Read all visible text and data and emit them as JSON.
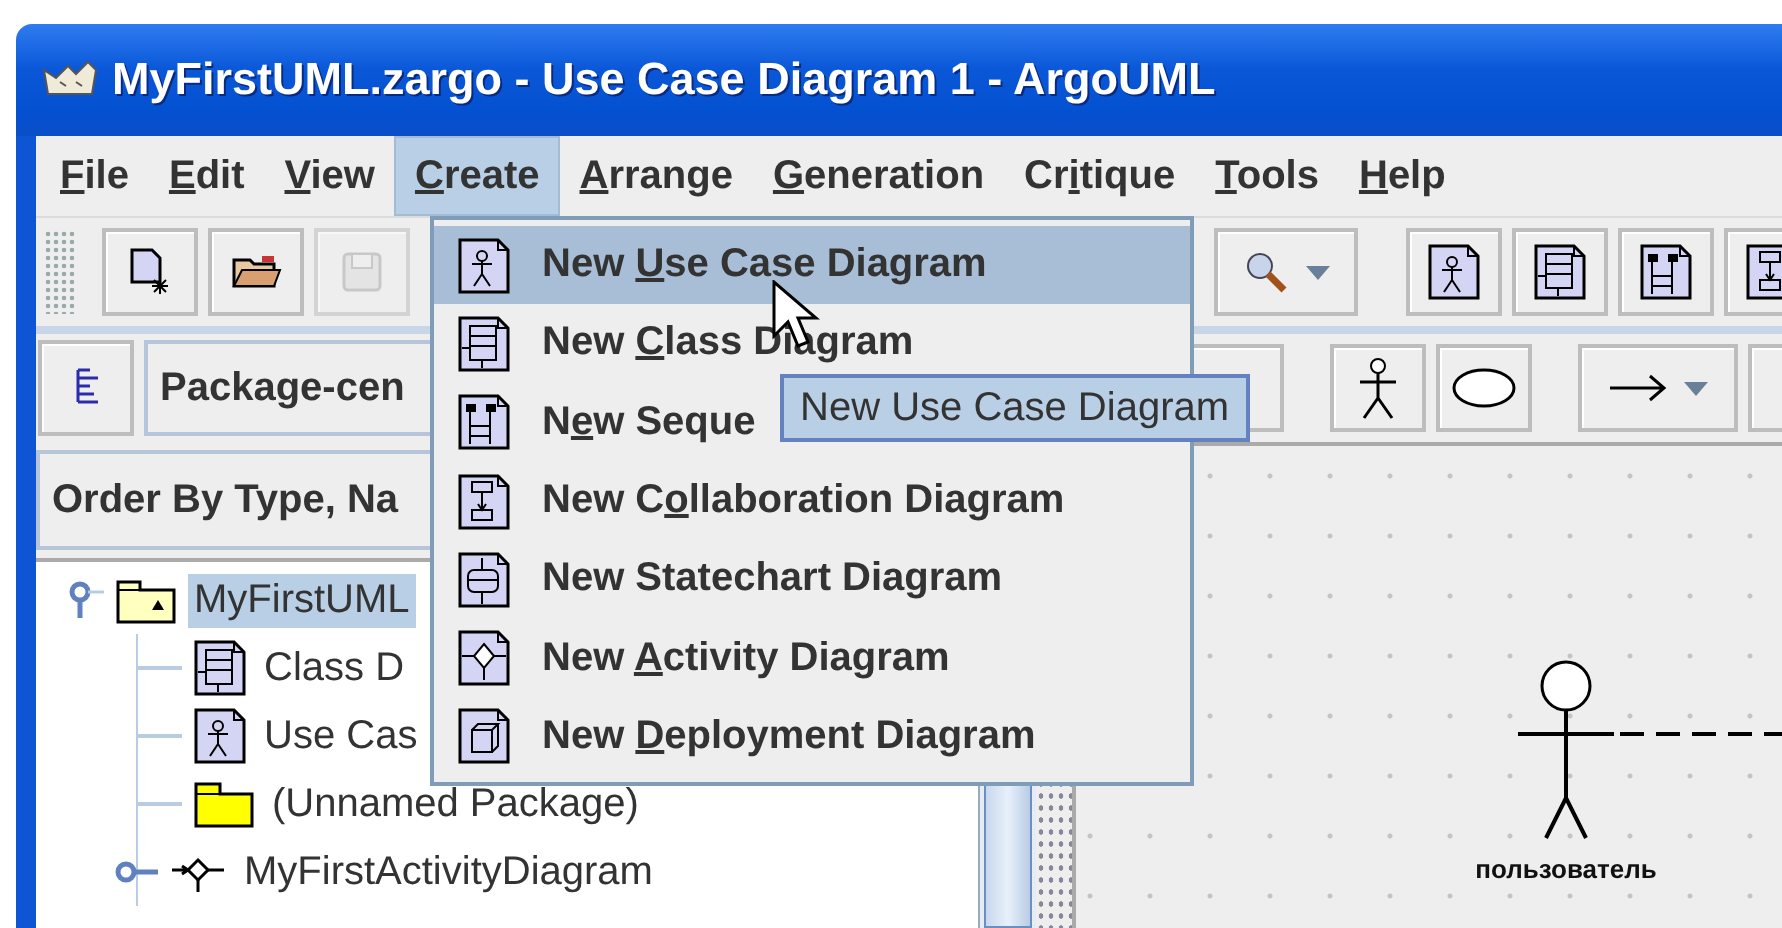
{
  "window": {
    "title": "MyFirstUML.zargo - Use Case Diagram 1 - ArgoUML"
  },
  "menu_bar": [
    {
      "label": {
        "key": "F",
        "after": "ile"
      },
      "selected": false
    },
    {
      "label": {
        "key": "E",
        "after": "dit"
      },
      "selected": false
    },
    {
      "label": {
        "key": "V",
        "after": "iew"
      },
      "selected": false
    },
    {
      "label": {
        "key": "C",
        "after": "reate"
      },
      "selected": true
    },
    {
      "label": {
        "key": "A",
        "after": "rrange"
      },
      "selected": false
    },
    {
      "label": {
        "key": "G",
        "after": "eneration"
      },
      "selected": false
    },
    {
      "label": {
        "before": "Cr",
        "key": "i",
        "after": "tique"
      },
      "selected": false
    },
    {
      "label": {
        "key": "T",
        "after": "ools"
      },
      "selected": false
    },
    {
      "label": {
        "key": "H",
        "after": "elp"
      },
      "selected": false
    }
  ],
  "toolbar": [
    {
      "kind": "new",
      "disabled": false
    },
    {
      "kind": "open",
      "disabled": false
    },
    {
      "kind": "save",
      "disabled": true
    }
  ],
  "create_menu": [
    {
      "kind": "usecase",
      "label": {
        "before": "New ",
        "key": "U",
        "after": "se Case Diagram"
      },
      "selected": true
    },
    {
      "kind": "class",
      "label": {
        "before": "New ",
        "key": "C",
        "after": "lass Diagram"
      },
      "selected": false
    },
    {
      "kind": "sequence",
      "label": {
        "before": "N",
        "key": "e",
        "after": "w Seque"
      },
      "selected": false
    },
    {
      "kind": "collaboration",
      "label": {
        "before": "New C",
        "key": "o",
        "after": "llaboration Diagram"
      },
      "selected": false
    },
    {
      "kind": "statechart",
      "label": {
        "before": "New Statechart Diagram"
      },
      "selected": false
    },
    {
      "kind": "activity",
      "label": {
        "before": "New ",
        "key": "A",
        "after": "ctivity Diagram"
      },
      "selected": false
    },
    {
      "kind": "deployment",
      "label": {
        "before": "New ",
        "key": "D",
        "after": "eployment Diagram"
      },
      "selected": false
    }
  ],
  "tooltip": "New Use Case Diagram",
  "explorer": {
    "perspective": "Package-cen",
    "order": "Order By Type, Na",
    "tree": [
      {
        "kind": "model",
        "label": "MyFirstUML",
        "selected": true,
        "expanded": true,
        "children": [
          {
            "kind": "class",
            "label": "Class D",
            "selected": false
          },
          {
            "kind": "usecase",
            "label": "Use Cas",
            "selected": false
          },
          {
            "kind": "package",
            "label": "(Unnamed Package)",
            "selected": false
          },
          {
            "kind": "activity",
            "label": "MyFirstActivityDiagram",
            "selected": false,
            "expanded": false
          }
        ]
      }
    ]
  },
  "diagram": {
    "actors": [
      {
        "name": "пользователь"
      }
    ]
  }
}
